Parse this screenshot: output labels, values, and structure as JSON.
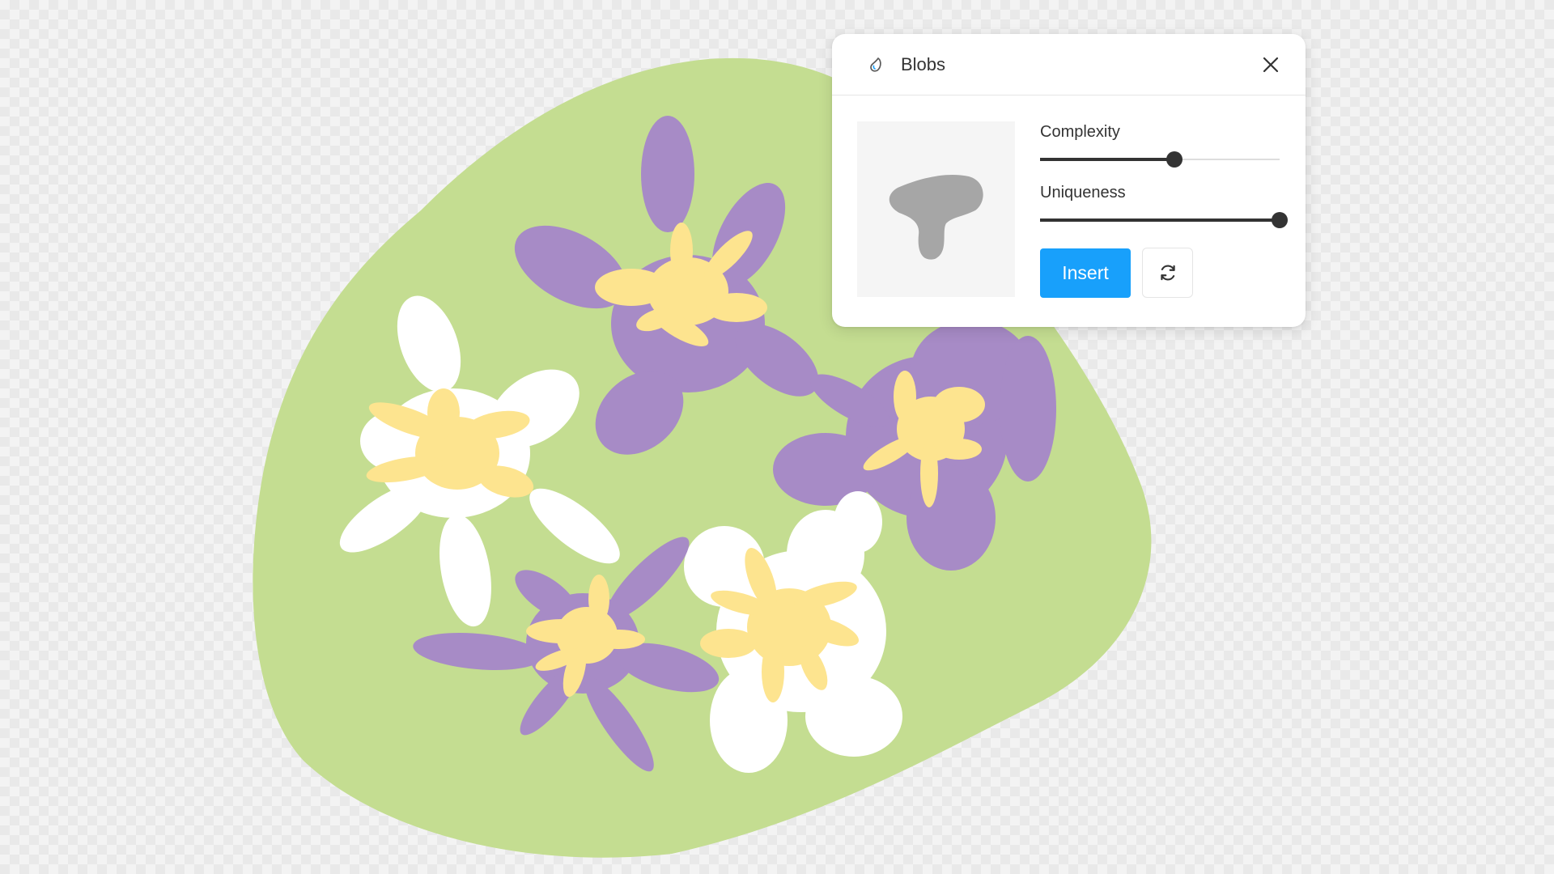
{
  "plugin": {
    "title": "Blobs",
    "icon": "blob-drop-icon",
    "close_icon": "close-icon"
  },
  "controls": {
    "complexity": {
      "label": "Complexity",
      "value": 0.56
    },
    "uniqueness": {
      "label": "Uniqueness",
      "value": 1.0
    }
  },
  "actions": {
    "insert_label": "Insert",
    "regenerate_icon": "refresh-icon"
  },
  "colors": {
    "accent": "#18a0fb",
    "green_blob": "#c4dd91",
    "purple_blob": "#a78bc6",
    "yellow_blob": "#fde48f",
    "white_blob": "#ffffff",
    "preview_blob": "#a6a6a6",
    "slider_active": "#333333"
  }
}
